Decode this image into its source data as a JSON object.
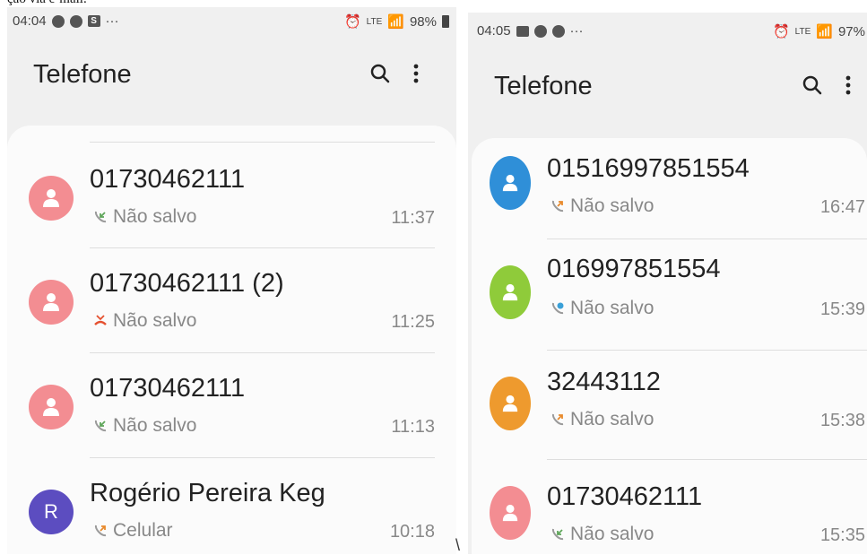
{
  "top_crop_text": "ção via e-mail.",
  "left": {
    "status": {
      "time": "04:04",
      "battery": "98%"
    },
    "title": "Telefone",
    "calls": [
      {
        "name": "01730462111",
        "type": "Não salvo",
        "time": "11:37",
        "call_icon": "incoming-call-icon",
        "avatar_color": "#f38d92",
        "avatar_letter": ""
      },
      {
        "name": "01730462111 (2)",
        "type": "Não salvo",
        "time": "11:25",
        "call_icon": "missed-call-icon",
        "avatar_color": "#f38d92",
        "avatar_letter": ""
      },
      {
        "name": "01730462111",
        "type": "Não salvo",
        "time": "11:13",
        "call_icon": "incoming-call-icon",
        "avatar_color": "#f38d92",
        "avatar_letter": ""
      },
      {
        "name": "Rogério Pereira Keg",
        "type": "Celular",
        "time": "10:18",
        "call_icon": "outgoing-call-icon",
        "avatar_color": "#5c4dc0",
        "avatar_letter": "R"
      }
    ]
  },
  "right": {
    "status": {
      "time": "04:05",
      "battery": "97%"
    },
    "title": "Telefone",
    "calls": [
      {
        "name": "01516997851554",
        "type": "Não salvo",
        "time": "16:47",
        "call_icon": "outgoing-call-icon",
        "avatar_color": "#2f8fd8",
        "avatar_letter": ""
      },
      {
        "name": "016997851554",
        "type": "Não salvo",
        "time": "15:39",
        "call_icon": "wifi-call-icon",
        "avatar_color": "#8fcb3a",
        "avatar_letter": ""
      },
      {
        "name": "32443112",
        "type": "Não salvo",
        "time": "15:38",
        "call_icon": "outgoing-call-icon",
        "avatar_color": "#ee9a2e",
        "avatar_letter": ""
      },
      {
        "name": "01730462111",
        "type": "Não salvo",
        "time": "15:35",
        "call_icon": "incoming-call-icon",
        "avatar_color": "#f38d92",
        "avatar_letter": ""
      }
    ]
  },
  "stray_mark": "\\",
  "colors": {
    "incoming": "#5fa65a",
    "missed": "#e5502f",
    "outgoing": "#e88a2c",
    "wifi": "#3aa0d8"
  }
}
